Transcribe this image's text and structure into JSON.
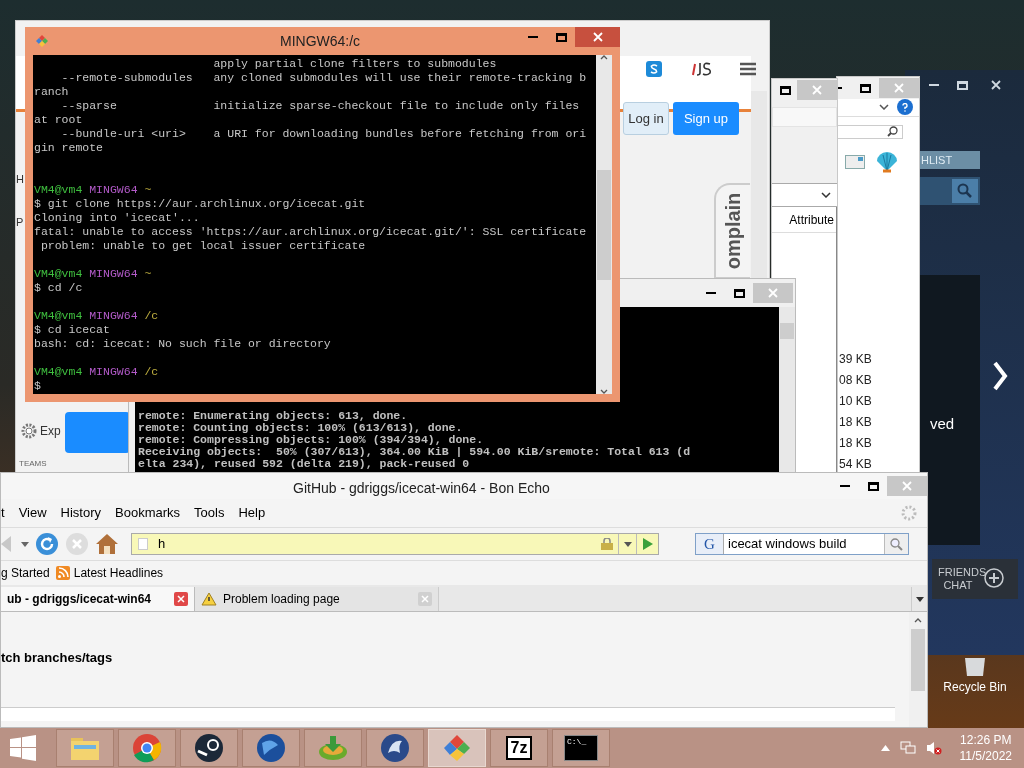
{
  "back_browser": {
    "buttons": [
      {
        "label": "Log in",
        "kind": "secondary"
      },
      {
        "label": "Sign up",
        "kind": "primary"
      }
    ],
    "feedback_tab": "omplain",
    "side_letters": [
      "H",
      "P"
    ],
    "sidebar_item": "Exp",
    "section_heading": "TEAMS"
  },
  "attribute_window": {
    "column": "Attribute"
  },
  "explorer_window": {
    "sizes": [
      "39 KB",
      "08 KB",
      "10 KB",
      "18 KB",
      "18 KB",
      "54 KB"
    ]
  },
  "steam_window": {
    "wishlist": "HLIST",
    "side_text": "ved",
    "friends_chat": "FRIENDS CHAT"
  },
  "console_window": {
    "lines": [
      "remote: Enumerating objects: 613, done.",
      "remote: Counting objects: 100% (613/613), done.",
      "remote: Compressing objects: 100% (394/394), done.",
      "Receiving objects:  50% (307/613), 364.00 KiB | 594.00 KiB/sremote: Total 613 (d",
      "elta 234), reused 592 (delta 219), pack-reused 0"
    ]
  },
  "mingw_window": {
    "title": "MINGW64:/c",
    "lines": [
      {
        "kind": "output",
        "text": "                          apply partial clone filters to submodules"
      },
      {
        "kind": "output",
        "text": "    --remote-submodules   any cloned submodules will use their remote-tracking b"
      },
      {
        "kind": "output",
        "text": "ranch"
      },
      {
        "kind": "output",
        "text": "    --sparse              initialize sparse-checkout file to include only files"
      },
      {
        "kind": "output",
        "text": "at root"
      },
      {
        "kind": "output",
        "text": "    --bundle-uri <uri>    a URI for downloading bundles before fetching from ori"
      },
      {
        "kind": "output",
        "text": "gin remote"
      },
      {
        "kind": "blank"
      },
      {
        "kind": "blank"
      },
      {
        "kind": "prompt",
        "user": "VM4@vm4",
        "shell": "MINGW64",
        "path": "~"
      },
      {
        "kind": "output",
        "text": "$ git clone https://aur.archlinux.org/icecat.git"
      },
      {
        "kind": "output",
        "text": "Cloning into 'icecat'..."
      },
      {
        "kind": "output",
        "text": "fatal: unable to access 'https://aur.archlinux.org/icecat.git/': SSL certificate"
      },
      {
        "kind": "output",
        "text": " problem: unable to get local issuer certificate"
      },
      {
        "kind": "blank"
      },
      {
        "kind": "prompt",
        "user": "VM4@vm4",
        "shell": "MINGW64",
        "path": "~"
      },
      {
        "kind": "output",
        "text": "$ cd /c"
      },
      {
        "kind": "blank"
      },
      {
        "kind": "prompt",
        "user": "VM4@vm4",
        "shell": "MINGW64",
        "path": "/c"
      },
      {
        "kind": "output",
        "text": "$ cd icecat"
      },
      {
        "kind": "output",
        "text": "bash: cd: icecat: No such file or directory"
      },
      {
        "kind": "blank"
      },
      {
        "kind": "prompt",
        "user": "VM4@vm4",
        "shell": "MINGW64",
        "path": "/c"
      },
      {
        "kind": "output",
        "text": "$"
      }
    ]
  },
  "browser": {
    "title": "GitHub - gdriggs/icecat-win64 - Bon Echo",
    "menu": [
      "t",
      "View",
      "History",
      "Bookmarks",
      "Tools",
      "Help"
    ],
    "address": "h",
    "search_engine": "G",
    "search": "icecat windows build",
    "bookmarks": [
      {
        "label": "g Started",
        "kind": "plain"
      },
      {
        "label": "Latest Headlines",
        "kind": "feed"
      }
    ],
    "tabs": [
      {
        "label": "ub - gdriggs/icecat-win64",
        "selected": true
      },
      {
        "label": "Problem loading page",
        "selected": false
      }
    ],
    "content": "tch branches/tags"
  },
  "desktop": {
    "icons": [
      {
        "label": "Recycle Bin"
      }
    ]
  },
  "taskbar": {
    "apps": [
      {
        "kind": "folder",
        "selected": false
      },
      {
        "kind": "chrome",
        "selected": false
      },
      {
        "kind": "steam",
        "selected": false
      },
      {
        "kind": "globe",
        "selected": false
      },
      {
        "kind": "download",
        "selected": false
      },
      {
        "kind": "bird",
        "selected": false
      },
      {
        "kind": "git",
        "selected": true
      },
      {
        "kind": "archive",
        "label": "7z",
        "selected": false
      },
      {
        "kind": "terminal",
        "label": "C:\\_",
        "selected": false
      }
    ],
    "clock": {
      "time": "12:26 PM",
      "date": "11/5/2022"
    }
  }
}
